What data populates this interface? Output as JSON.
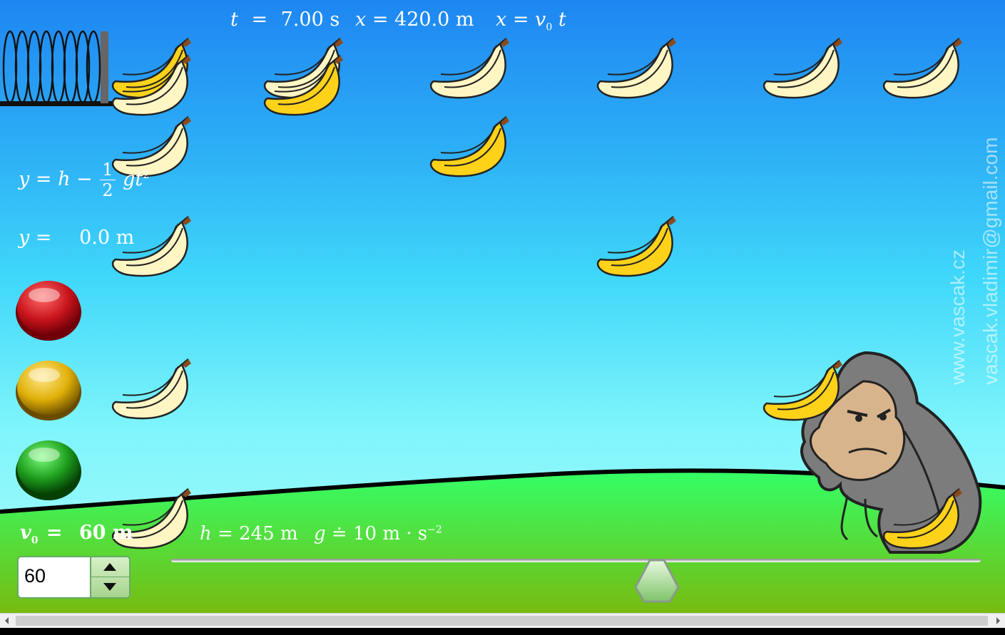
{
  "header": {
    "t_label": "t",
    "t_eq": "=",
    "t_value": "7.00 s",
    "x_label": "x",
    "x_eq": "=",
    "x_value": "420.0 m",
    "x_formula_lhs": "x",
    "x_formula_eq": "=",
    "x_formula_v": "v",
    "x_formula_sub": "0",
    "x_formula_t": "t"
  },
  "left_panel": {
    "y_formula_lhs": "y",
    "y_formula_mid": "= h −",
    "y_formula_num": "1",
    "y_formula_den": "2",
    "y_formula_tail": "gt",
    "y_formula_sup": "2",
    "y_label": "y",
    "y_eq": "=",
    "y_value": "0.0 m"
  },
  "bottom": {
    "v0_label": "v",
    "v0_sub": "0",
    "v0_eq": "=",
    "v0_value": "60 m",
    "h_label": "h",
    "h_value": "= 245 m",
    "g_label": "g",
    "g_value": "≐ 10 m · s",
    "g_exp": "−2"
  },
  "controls": {
    "speed_input_value": "60",
    "slider_level": 0.6
  },
  "watermark": {
    "line1": "www.vascak.cz",
    "line2": "vascak.vladimir@gmail.com"
  },
  "buttons": [
    {
      "name": "red-button",
      "color": "#c8141c"
    },
    {
      "name": "yellow-button",
      "color": "#e0b008"
    },
    {
      "name": "green-button",
      "color": "#1c9a1c"
    }
  ],
  "colors": {
    "sky_top": "#1e86f2",
    "sky_bottom": "#a9fbfb",
    "grass_top": "#33ff66",
    "grass_bottom": "#77bb11",
    "banana_pale": "#fff6c4",
    "banana_ripe": "#ffd21a"
  }
}
